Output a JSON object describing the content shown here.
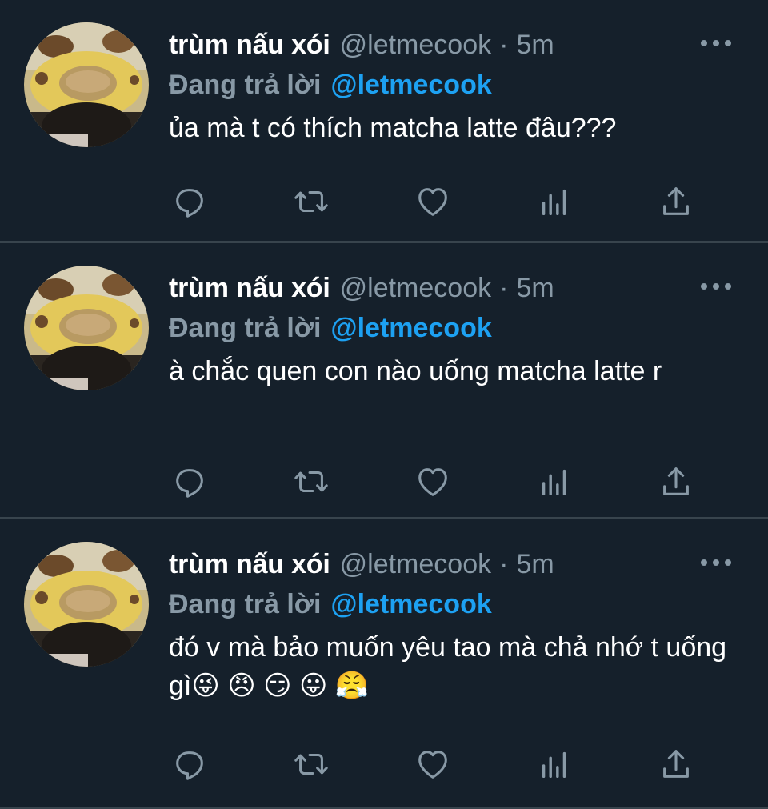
{
  "tweets": [
    {
      "name": "trùm nấu xói",
      "handle": "@letmecook",
      "separator": "·",
      "time": "5m",
      "reply_prefix": "Đang trả lời",
      "reply_to": "@letmecook",
      "text": "ủa mà t có thích matcha latte đâu???"
    },
    {
      "name": "trùm nấu xói",
      "handle": "@letmecook",
      "separator": "·",
      "time": "5m",
      "reply_prefix": "Đang trả lời",
      "reply_to": "@letmecook",
      "text": "à chắc quen con nào uống matcha latte r"
    },
    {
      "name": "trùm nấu xói",
      "handle": "@letmecook",
      "separator": "·",
      "time": "5m",
      "reply_prefix": "Đang trả lời",
      "reply_to": "@letmecook",
      "text": "đó v mà bảo muốn yêu tao mà chả nhớ t uống gì😜 😠 😏 😛 😤"
    }
  ],
  "icons": {
    "more": "more-horizontal-icon",
    "reply": "reply-icon",
    "retweet": "retweet-icon",
    "like": "heart-icon",
    "analytics": "analytics-icon",
    "share": "share-icon",
    "avatar": "avatar-image"
  },
  "colors": {
    "background": "#15202b",
    "divider": "#38444d",
    "secondary_text": "#8899a6",
    "link": "#1da1f2",
    "primary_text": "#ffffff"
  }
}
